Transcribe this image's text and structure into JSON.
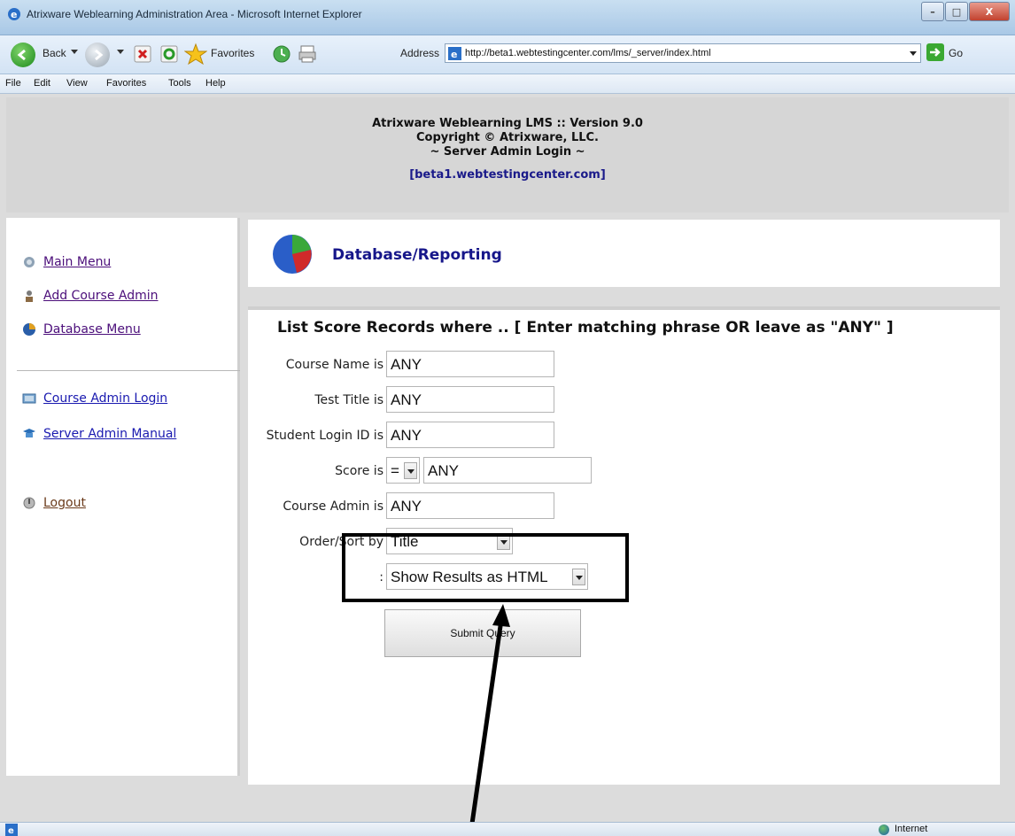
{
  "window": {
    "title": "Atrixware Weblearning Administration Area - Microsoft Internet Explorer"
  },
  "toolbar": {
    "back_label": "Back",
    "favorites_label": "Favorites",
    "address_label": "Address",
    "url": "http://beta1.webtestingcenter.com/lms/_server/index.html",
    "go_label": "Go"
  },
  "menubar": {
    "items": [
      "File",
      "Edit",
      "View",
      "Favorites",
      "Tools",
      "Help"
    ]
  },
  "banner": {
    "line1": "Atrixware Weblearning LMS :: Version 9.0",
    "line2": "Copyright © Atrixware, LLC.",
    "line3": "~ Server Admin Login ~",
    "host": "[beta1.webtestingcenter.com]"
  },
  "sidebar": {
    "items": [
      {
        "label": "Main Menu",
        "icon": "main-menu-icon"
      },
      {
        "label": "Add Course Admin",
        "icon": "add-admin-icon"
      },
      {
        "label": "Database Menu",
        "icon": "database-icon"
      },
      {
        "label": "Course Admin Login",
        "icon": "login-icon"
      },
      {
        "label": "Server Admin Manual",
        "icon": "manual-icon"
      },
      {
        "label": "Logout",
        "icon": "logout-icon"
      }
    ]
  },
  "panel": {
    "title": "Database/Reporting"
  },
  "form": {
    "heading": "List Score Records where .. [ Enter matching phrase OR leave as \"ANY\" ]",
    "course_name_label": "Course Name is",
    "course_name_value": "ANY",
    "test_title_label": "Test Title is",
    "test_title_value": "ANY",
    "student_label": "Student Login ID is",
    "student_value": "ANY",
    "score_label": "Score is",
    "score_operator": "=",
    "score_value": "ANY",
    "course_admin_label": "Course Admin is",
    "course_admin_value": "ANY",
    "order_label": "Order/Sort by",
    "order_value": "Title",
    "results_label": ":",
    "results_value": "Show Results as HTML",
    "submit_label": "Submit Query"
  },
  "statusbar": {
    "zone": "Internet"
  }
}
